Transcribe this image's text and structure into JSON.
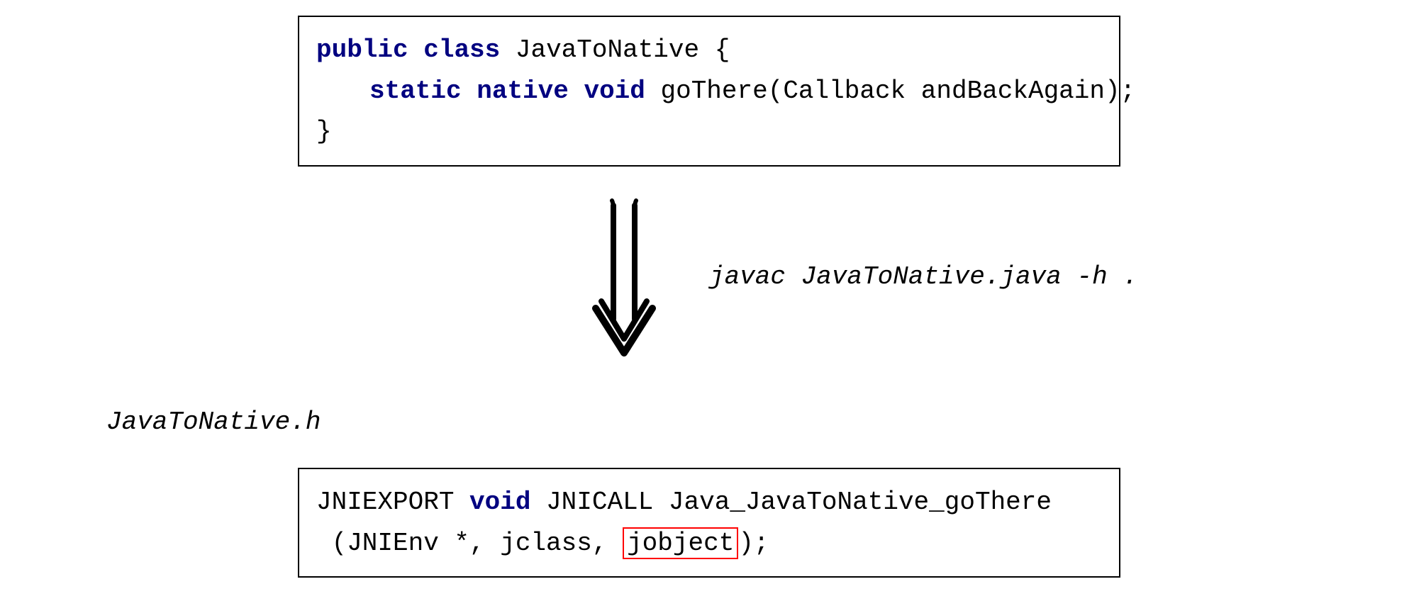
{
  "topBox": {
    "line1": {
      "kw1": "public",
      "kw2": "class",
      "rest": " JavaToNative {"
    },
    "line2": {
      "kw1": "static",
      "kw2": "native",
      "kw3": "void",
      "rest": " goThere(Callback andBackAgain);"
    },
    "line3": "}"
  },
  "command": "javac JavaToNative.java -h .",
  "fileLabel": "JavaToNative.h",
  "bottomBox": {
    "line1": {
      "part1": "JNIEXPORT ",
      "kw": "void",
      "part2": " JNICALL Java_JavaToNative_goThere"
    },
    "line2": {
      "part1": " (JNIEnv *, jclass, ",
      "highlighted": "jobject",
      "part2": ");"
    }
  }
}
